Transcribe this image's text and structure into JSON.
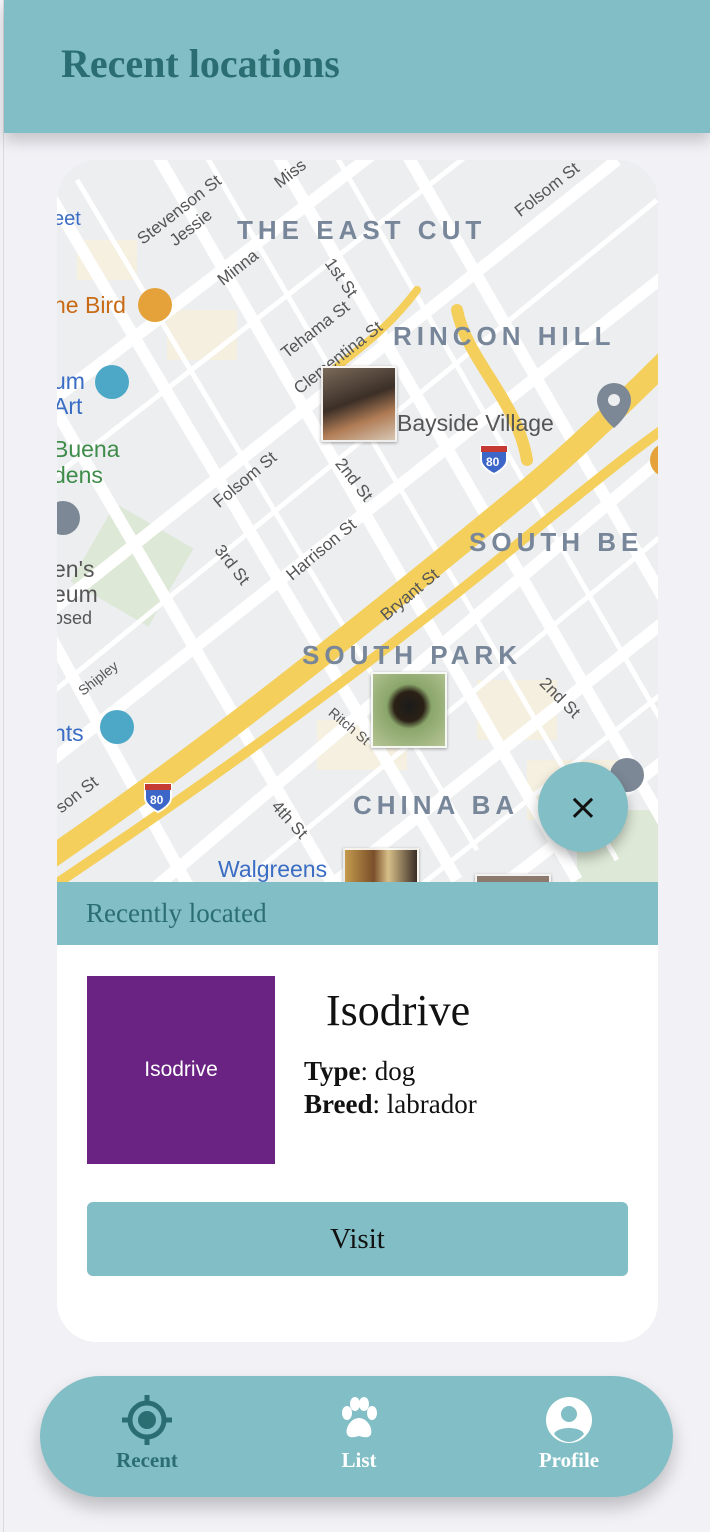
{
  "header": {
    "title": "Recent locations"
  },
  "map": {
    "districts": [
      "THE EAST CUT",
      "RINCON HILL",
      "SOUTH BE",
      "SOUTH PARK",
      "CHINA BA"
    ],
    "streets": [
      "Stevenson St",
      "Jessie",
      "Minna",
      "1st St",
      "Tehama St",
      "Clementina St",
      "Folsom St",
      "2nd St",
      "Harrison St",
      "3rd St",
      "Bryant St",
      "Ritch St",
      "2nd St",
      "Shipley",
      "4th St",
      "son St",
      "Folsom St",
      "Miss"
    ],
    "pois": [
      "he Bird",
      "um",
      "Art",
      "Buena",
      "dens",
      "en's",
      "eum",
      "osed",
      "nts",
      "Walgreens",
      "Bayside Village",
      "eet"
    ],
    "highway_shield": "80",
    "close_icon": "×"
  },
  "sheet": {
    "header_label": "Recently located",
    "pet": {
      "thumb_text": "Isodrive",
      "name": "Isodrive",
      "type_label": "Type",
      "type_value": ": dog",
      "breed_label": "Breed",
      "breed_value": ": labrador"
    },
    "visit_label": "Visit"
  },
  "nav": {
    "items": [
      {
        "label": "Recent",
        "icon": "crosshair-icon",
        "active": true
      },
      {
        "label": "List",
        "icon": "paw-icon",
        "active": false
      },
      {
        "label": "Profile",
        "icon": "account-circle-icon",
        "active": false
      }
    ]
  },
  "colors": {
    "accent": "#82bec5",
    "accent_dark": "#2b6e72",
    "thumb": "#6a2383",
    "background": "#f1f1f6"
  }
}
